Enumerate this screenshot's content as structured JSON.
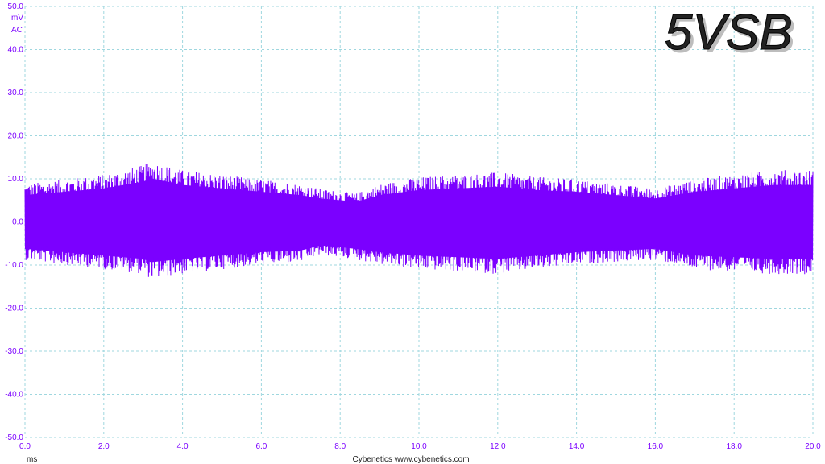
{
  "chart_data": {
    "type": "line",
    "title": "5VSB",
    "y_unit": "mV",
    "y_coupling": "AC",
    "x_unit": "ms",
    "footer": "Cybenetics   www.cybenetics.com",
    "xlim": [
      0,
      20
    ],
    "ylim": [
      -50,
      50
    ],
    "x_ticks": [
      "0.0",
      "2.0",
      "4.0",
      "6.0",
      "8.0",
      "10.0",
      "12.0",
      "14.0",
      "16.0",
      "18.0",
      "20.0"
    ],
    "y_ticks": [
      "50.0",
      "40.0",
      "30.0",
      "20.0",
      "10.0",
      "0.0",
      "-10.0",
      "-20.0",
      "-30.0",
      "-40.0",
      "-50.0"
    ],
    "grid": true,
    "series": [
      {
        "color": "#7b00ff",
        "envelope": {
          "x": [
            0,
            1,
            2,
            3,
            3.2,
            4,
            5,
            6,
            7,
            7.5,
            8,
            8.4,
            9,
            10,
            11,
            12,
            13,
            14,
            15,
            16,
            16.5,
            17,
            18,
            19,
            20
          ],
          "upper": [
            8,
            9,
            10,
            12,
            13,
            11,
            10,
            9,
            8,
            7,
            6.5,
            6,
            8,
            9.5,
            10,
            10.5,
            9.5,
            9,
            8,
            7,
            8,
            9,
            10,
            11,
            11
          ],
          "lower": [
            -8,
            -9,
            -10,
            -11,
            -12,
            -11,
            -10,
            -9,
            -8.5,
            -7,
            -7.5,
            -8,
            -9,
            -10,
            -10.5,
            -11,
            -10,
            -9,
            -8.5,
            -8,
            -9,
            -10,
            -10.5,
            -11,
            -11
          ]
        }
      }
    ]
  },
  "colors": {
    "signal": "#7b00ff",
    "grid": "#9fd7df",
    "axis_text": "#7b00ff"
  }
}
